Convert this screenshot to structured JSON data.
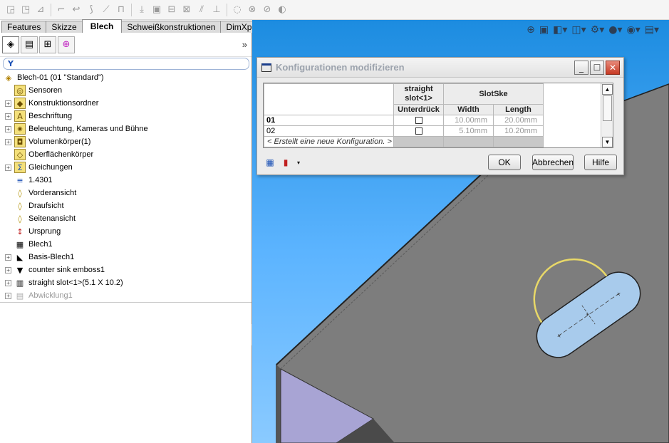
{
  "toolbar": {
    "icons": [
      "sheet-metal-icon",
      "extruded-flange-icon",
      "edge-flange-icon",
      "miter-flange-icon",
      "hem-icon",
      "jog-icon",
      "sketched-bend-icon",
      "closed-corner-icon",
      "unfold-icon",
      "fold-icon",
      "flatten-icon",
      "no-bends-icon",
      "rip-icon",
      "insert-bends-icon",
      "forming-tool-icon",
      "vent-icon",
      "cross-break-icon",
      "corner-relief-icon"
    ]
  },
  "cm_tabs": [
    {
      "label": "Features",
      "active": false
    },
    {
      "label": "Skizze",
      "active": false
    },
    {
      "label": "Blech",
      "active": true
    },
    {
      "label": "Schweißkonstruktionen",
      "active": false
    },
    {
      "label": "DimXpert",
      "active": false
    }
  ],
  "panel": {
    "more_label": "»",
    "tree": [
      {
        "label": "Blech-01  (01 \"Standard\")",
        "icon": "part-icon",
        "expand": false,
        "indent": 0,
        "grey": false
      },
      {
        "label": "Sensoren",
        "icon": "sensor-icon",
        "expand": false,
        "indent": 1,
        "grey": false
      },
      {
        "label": "Konstruktionsordner",
        "icon": "folder-icon",
        "expand": true,
        "indent": 1,
        "grey": false
      },
      {
        "label": "Beschriftung",
        "icon": "annotation-icon",
        "expand": true,
        "indent": 1,
        "grey": false
      },
      {
        "label": "Beleuchtung, Kameras und Bühne",
        "icon": "lighting-icon",
        "expand": true,
        "indent": 1,
        "grey": false
      },
      {
        "label": "Volumenkörper(1)",
        "icon": "solid-bodies-icon",
        "expand": true,
        "indent": 1,
        "grey": false
      },
      {
        "label": "Oberflächenkörper",
        "icon": "surface-bodies-icon",
        "expand": false,
        "indent": 1,
        "grey": false
      },
      {
        "label": "Gleichungen",
        "icon": "equations-icon",
        "expand": true,
        "indent": 1,
        "grey": false
      },
      {
        "label": "1.4301",
        "icon": "material-icon",
        "expand": false,
        "indent": 1,
        "grey": false
      },
      {
        "label": "Vorderansicht",
        "icon": "plane-icon",
        "expand": false,
        "indent": 1,
        "grey": false
      },
      {
        "label": "Draufsicht",
        "icon": "plane-icon",
        "expand": false,
        "indent": 1,
        "grey": false
      },
      {
        "label": "Seitenansicht",
        "icon": "plane-icon",
        "expand": false,
        "indent": 1,
        "grey": false
      },
      {
        "label": "Ursprung",
        "icon": "origin-icon",
        "expand": false,
        "indent": 1,
        "grey": false
      },
      {
        "label": "Blech1",
        "icon": "sheet-metal-feature-icon",
        "expand": false,
        "indent": 1,
        "grey": false
      },
      {
        "label": "Basis-Blech1",
        "icon": "base-flange-icon",
        "expand": true,
        "indent": 1,
        "grey": false
      },
      {
        "label": "counter sink emboss1",
        "icon": "emboss-icon",
        "expand": true,
        "indent": 1,
        "grey": false
      },
      {
        "label": "straight slot<1>(5.1 X 10.2)",
        "icon": "library-feature-icon",
        "expand": true,
        "indent": 1,
        "grey": false
      },
      {
        "label": "Abwicklung1",
        "icon": "flat-pattern-icon",
        "expand": true,
        "indent": 1,
        "grey": true
      }
    ]
  },
  "dialog": {
    "title": "Konfigurationen modifizieren",
    "col_group1": "straight slot<1>",
    "col_group2": "SlotSke",
    "sub_cols": [
      "Unterdrück",
      "Width",
      "Length"
    ],
    "rows": [
      {
        "name": "01",
        "suppressed": false,
        "width": "10.00mm",
        "length": "20.00mm",
        "bold": true
      },
      {
        "name": "02",
        "suppressed": false,
        "width": "5.10mm",
        "length": "10.20mm",
        "bold": false
      }
    ],
    "new_config": "< Erstellt eine neue Konfiguration. >",
    "ok_label": "OK",
    "cancel_label": "Abbrechen",
    "help_label": "Hilfe"
  },
  "colors": {
    "viewport_top": "#1c8ce0",
    "viewport_bottom": "#8acaff",
    "model_face": "#7a7a7a",
    "slot_fill": "#a8c8e8",
    "inner_face": "#a8a4d4"
  }
}
